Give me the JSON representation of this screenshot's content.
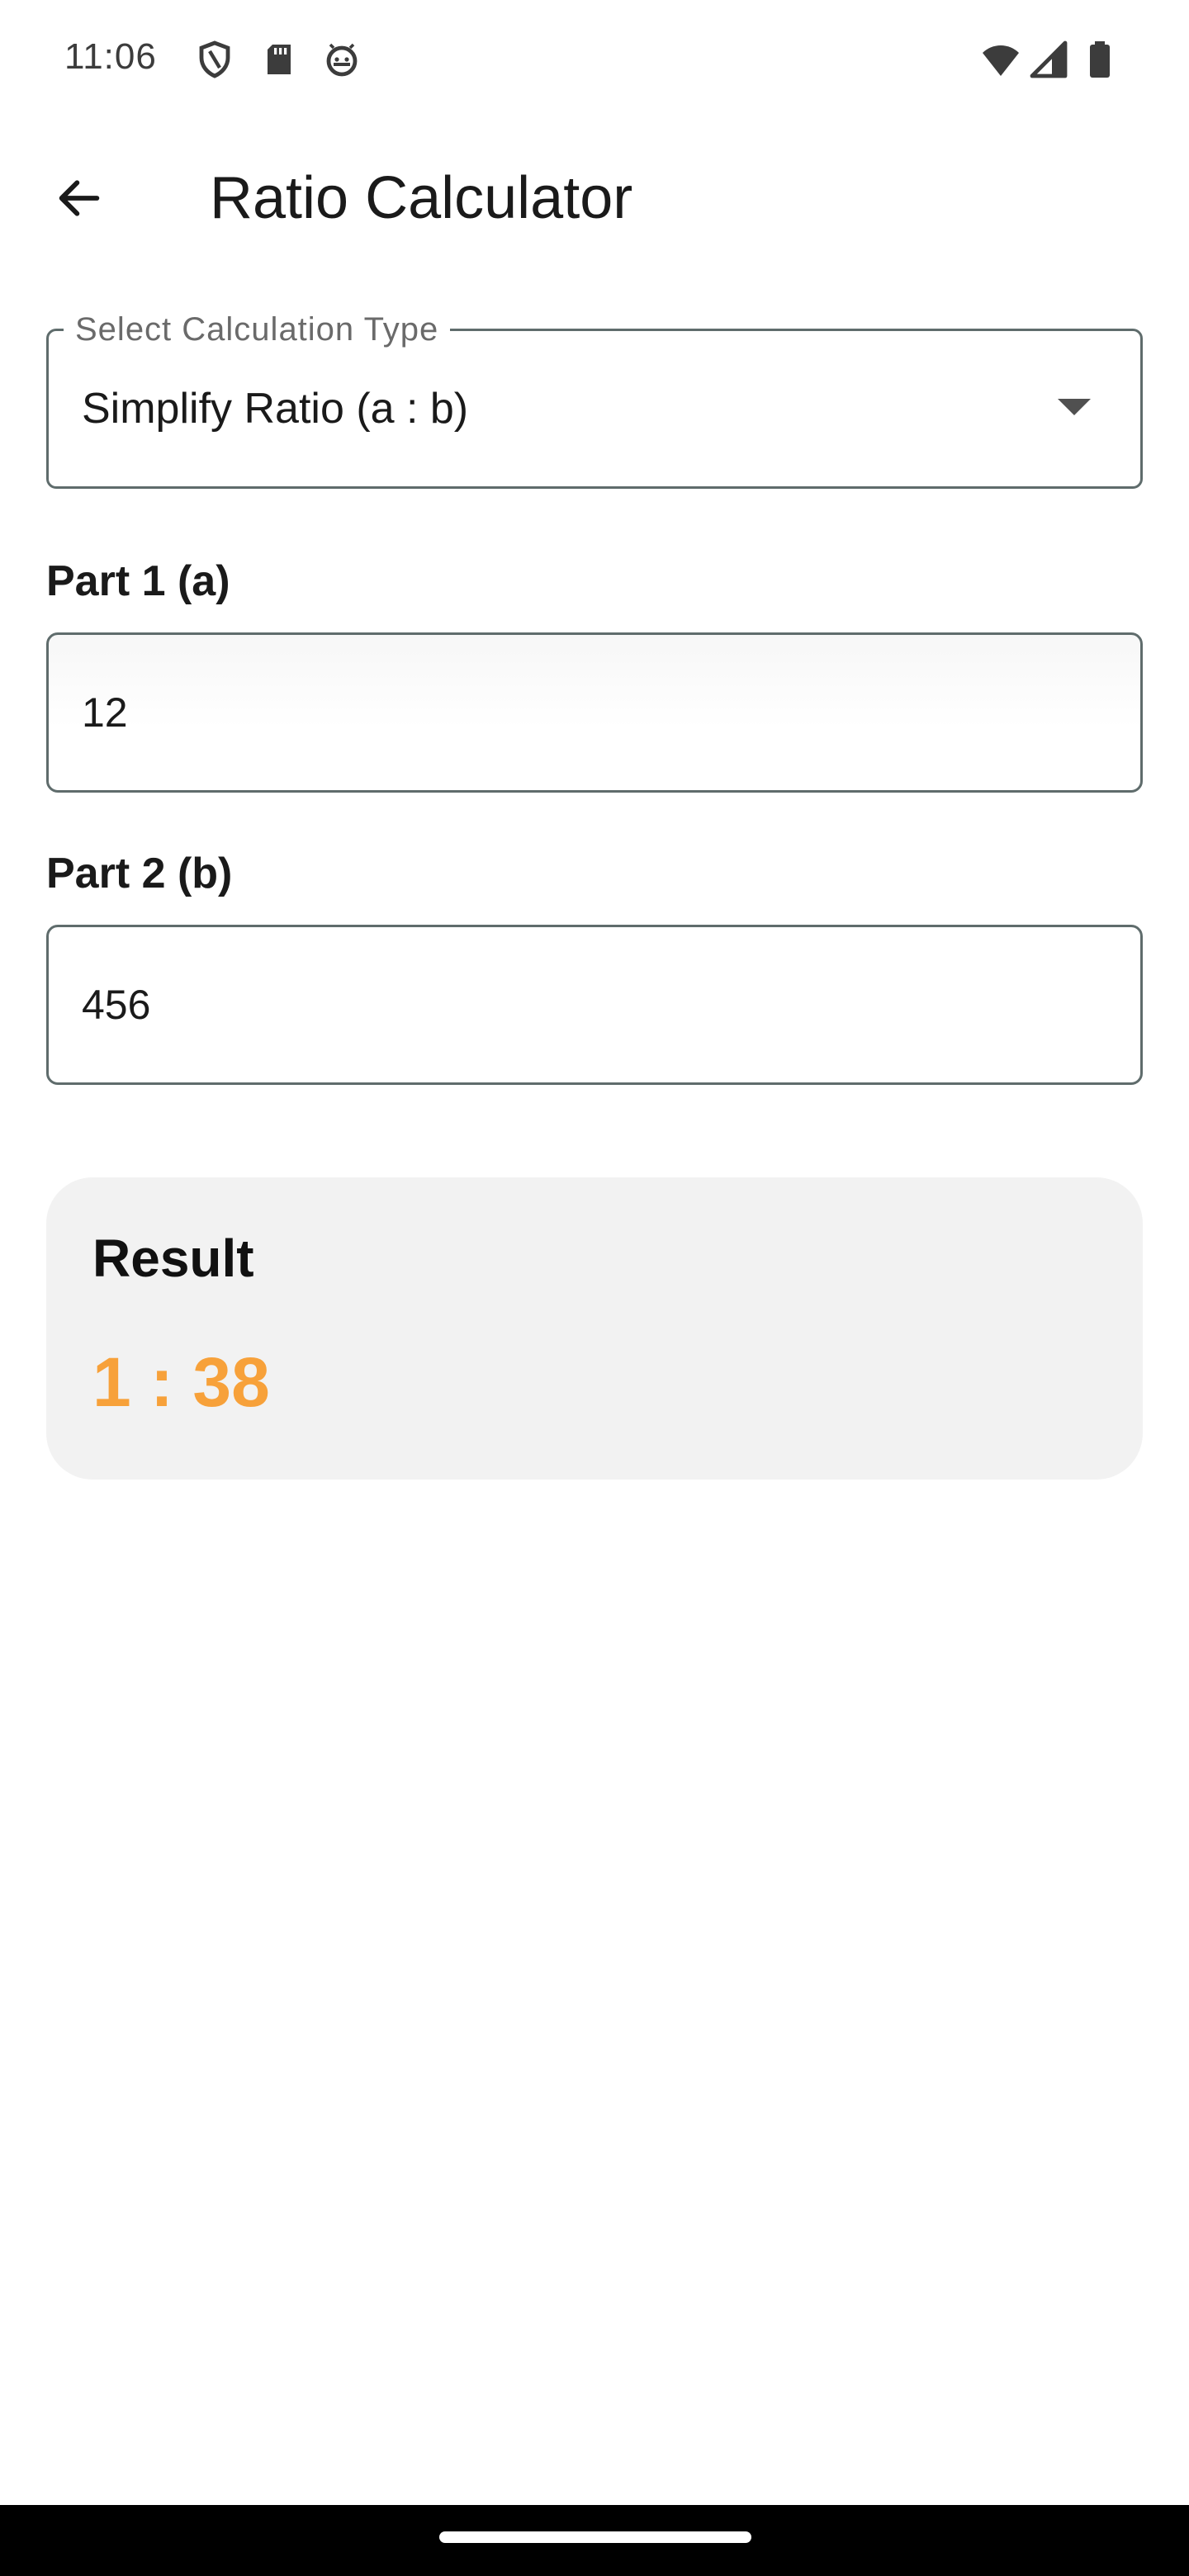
{
  "status_bar": {
    "time": "11:06",
    "left_icons": [
      "shield-icon",
      "sd-card-icon",
      "android-debug-icon"
    ],
    "right_icons": [
      "wifi-icon",
      "cellular-signal-icon",
      "battery-icon"
    ]
  },
  "app_bar": {
    "title": "Ratio Calculator",
    "back_icon": "arrow-back-icon"
  },
  "calculation_type": {
    "label": "Select Calculation Type",
    "selected": "Simplify Ratio (a : b)",
    "caret_icon": "dropdown-caret-icon"
  },
  "part1": {
    "label": "Part 1 (a)",
    "value": "12"
  },
  "part2": {
    "label": "Part 2 (b)",
    "value": "456"
  },
  "result": {
    "title": "Result",
    "value": "1 : 38"
  },
  "colors": {
    "accent": "#f7a13a",
    "card_background": "#f2f2f2",
    "border": "#5f6c6c"
  }
}
